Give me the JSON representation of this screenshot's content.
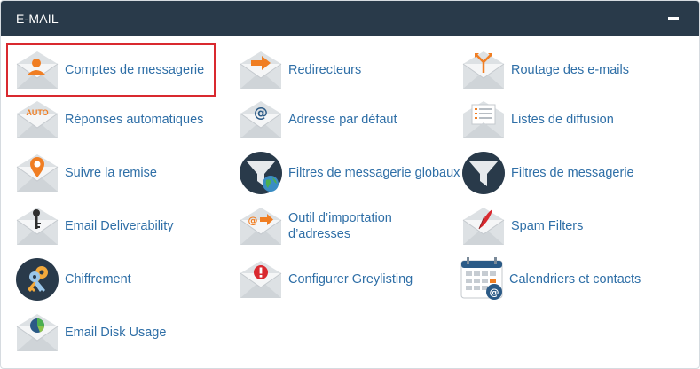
{
  "panel": {
    "title": "E-MAIL",
    "collapse_icon": "minus-icon"
  },
  "colors": {
    "header_bg": "#293a4a",
    "link": "#2f6fa7",
    "accent_orange": "#f07e23",
    "selected_outline": "#d9292f",
    "envelope": "#dde1e4"
  },
  "items": [
    {
      "label": "Comptes de messagerie",
      "icon": "user-envelope-icon",
      "selected": true
    },
    {
      "label": "Redirecteurs",
      "icon": "forward-arrow-envelope-icon"
    },
    {
      "label": "Routage des e-mails",
      "icon": "route-fork-envelope-icon"
    },
    {
      "label": "Réponses automatiques",
      "icon": "auto-envelope-icon",
      "badge": "AUTO"
    },
    {
      "label": "Adresse par défaut",
      "icon": "at-envelope-icon"
    },
    {
      "label": "Listes de diffusion",
      "icon": "list-envelope-icon"
    },
    {
      "label": "Suivre la remise",
      "icon": "location-pin-envelope-icon"
    },
    {
      "label": "Filtres de messagerie globaux",
      "icon": "global-filter-funnel-icon"
    },
    {
      "label": "Filtres de messagerie",
      "icon": "filter-funnel-icon"
    },
    {
      "label": "Email Deliverability",
      "icon": "key-envelope-icon"
    },
    {
      "label": "Outil d’importation d’adresses",
      "line1": "Outil d’importation",
      "line2": "d’adresses",
      "icon": "import-address-envelope-icon"
    },
    {
      "label": "Spam Filters",
      "icon": "spam-quill-envelope-icon"
    },
    {
      "label": "Chiffrement",
      "icon": "encryption-keys-icon"
    },
    {
      "label": "Configurer Greylisting",
      "icon": "greylisting-alert-envelope-icon"
    },
    {
      "label": "Calendriers et contacts",
      "icon": "calendar-contacts-icon"
    },
    {
      "label": "Email Disk Usage",
      "icon": "disk-usage-pie-envelope-icon"
    }
  ]
}
